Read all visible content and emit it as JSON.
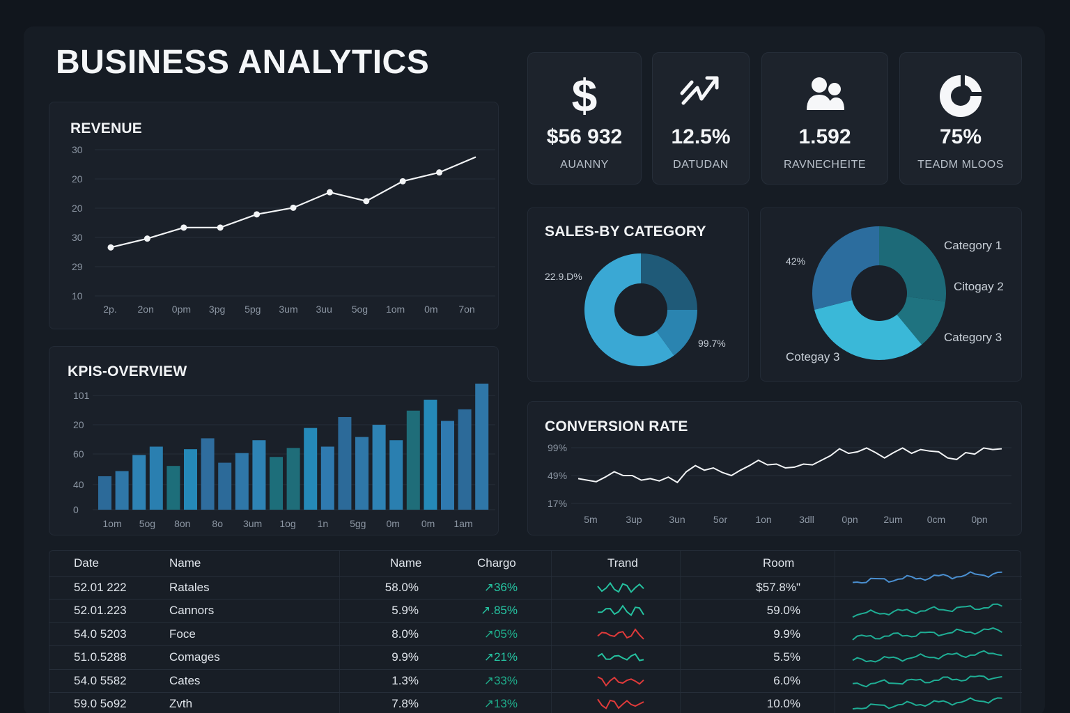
{
  "header": {
    "title": "BUSINESS ANALYTICS"
  },
  "kpi_cards": [
    {
      "icon": "dollar-icon",
      "value": "$56 932",
      "label": "AUANNY"
    },
    {
      "icon": "trend-up-arrow-icon",
      "value": "12.5%",
      "label": "DATUDAN"
    },
    {
      "icon": "users-icon",
      "value": "1.592",
      "label": "RAVNECHEITE"
    },
    {
      "icon": "pie-segment-icon",
      "value": "75%",
      "label": "TEADM  MLOOS"
    }
  ],
  "colors": {
    "background": "#11161d",
    "panel": "#1a2029",
    "line": "#f2f4f6",
    "bar_blue": "#2f6f9e",
    "bar_teal": "#1d6e7a",
    "donut_light": "#3aa8d4",
    "donut_mid": "#2a84b0",
    "donut_dark": "#1f5a78",
    "table_green": "#25c2a0",
    "table_red": "#e03a3a"
  },
  "revenue": {
    "title": "REVENUE",
    "chart_data": {
      "type": "line",
      "title": "REVENUE",
      "x": [
        "2p.",
        "2on",
        "0pm",
        "3pg",
        "5pg",
        "3um",
        "3uu",
        "5og",
        "1om",
        "0m",
        "7on"
      ],
      "y_ticks": [
        "30",
        "20",
        "20",
        "30",
        "29",
        "10"
      ],
      "values": [
        10,
        14,
        19,
        19,
        25,
        28,
        35,
        31,
        40,
        44,
        51
      ],
      "ylim": [
        0,
        60
      ]
    }
  },
  "kpis_overview": {
    "title": "KPIS-OVERVIEW",
    "chart_data": {
      "type": "bar",
      "title": "KPIS-OVERVIEW",
      "x_ticks": [
        "1om",
        "5og",
        "8on",
        "8o",
        "3um",
        "1og",
        "1n",
        "5gg",
        "0m",
        "0m",
        "1am"
      ],
      "y_ticks": [
        "101",
        "20",
        "60",
        "40",
        "0"
      ],
      "values": [
        52,
        60,
        85,
        98,
        68,
        94,
        111,
        73,
        88,
        108,
        82,
        96,
        127,
        98,
        144,
        113,
        132,
        108,
        154,
        171,
        138,
        156,
        196
      ],
      "ylim": [
        0,
        210
      ]
    }
  },
  "sales_by_category": {
    "title": "SALES-BY CATEGORY",
    "label_left": "22.9.D%",
    "label_right": "99.7%",
    "chart_data": {
      "type": "pie",
      "title": "SALES-BY CATEGORY",
      "labels": [
        "22.9.D%",
        "99.7%"
      ],
      "values": [
        60,
        15,
        25
      ]
    }
  },
  "category_donut": {
    "pct_label": "42%",
    "legend": [
      "Category 1",
      "Citogay 2",
      "Category 3",
      "Cotegay 3"
    ],
    "chart_data": {
      "type": "pie",
      "labels": [
        "Category 1",
        "Citogay 2",
        "Category 3",
        "Cotegay 3"
      ],
      "values": [
        27,
        12,
        32,
        29
      ]
    }
  },
  "conversion_rate": {
    "title": "CONVERSION RATE",
    "chart_data": {
      "type": "line",
      "title": "CONVERSION RATE",
      "y_ticks": [
        "99%",
        "49%",
        "17%"
      ],
      "x_ticks": [
        "5m",
        "3up",
        "3un",
        "5or",
        "1on",
        "3dll",
        "0pn",
        "2um",
        "0cm",
        "0pn"
      ],
      "values": [
        36,
        34,
        32,
        38,
        45,
        40,
        40,
        34,
        36,
        33,
        38,
        31,
        45,
        53,
        47,
        50,
        44,
        40,
        47,
        53,
        60,
        54,
        55,
        50,
        51,
        55,
        54,
        60,
        66,
        75,
        69,
        71,
        76,
        70,
        63,
        70,
        76,
        69,
        74,
        72,
        71,
        63,
        61,
        70,
        68,
        76,
        74,
        75
      ],
      "ylim": [
        0,
        100
      ]
    }
  },
  "table": {
    "headers": [
      "Date",
      "Name",
      "Name",
      "Chargo",
      "Trand",
      "Room"
    ],
    "rows": [
      {
        "date": "52.01 222",
        "name": "Ratales",
        "value": "58.0%",
        "change": "↗36%",
        "trend": "green",
        "room": "$57.8%\""
      },
      {
        "date": "52.01.223",
        "name": "Cannors",
        "value": "5.9%",
        "change": "↗.85%",
        "trend": "green",
        "room": "59.0%"
      },
      {
        "date": "54.0 5203",
        "name": "Foce",
        "value": "8.0%",
        "change": "↗05%",
        "trend": "red",
        "room": "9.9%"
      },
      {
        "date": "51.0.5288",
        "name": "Comages",
        "value": "9.9%",
        "change": "↗21%",
        "trend": "green",
        "room": "5.5%"
      },
      {
        "date": "54.0 5582",
        "name": "Cates",
        "value": "1.3%",
        "change": "↗33%",
        "trend": "red",
        "room": "6.0%"
      },
      {
        "date": "59.0 5o92",
        "name": "Zvth",
        "value": "7.8%",
        "change": "↗13%",
        "trend": "red",
        "room": "10.0%"
      }
    ]
  }
}
